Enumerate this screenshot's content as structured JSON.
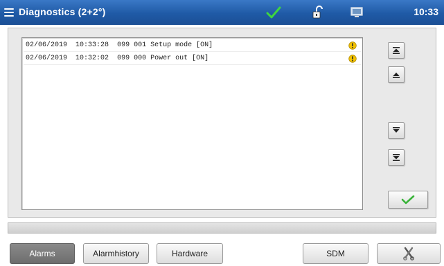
{
  "header": {
    "title": "Diagnostics (2+2°)",
    "time": "10:33",
    "menu_icon": "menu-icon",
    "status_icon": "checkmark-icon",
    "lock_icon": "lock-icon",
    "monitor_icon": "monitor-icon",
    "status_color": "#2fbf2f"
  },
  "alarms": [
    {
      "date": "02/06/2019",
      "time": "10:33:28",
      "code": "099 001",
      "message": "Setup mode [ON]",
      "icon": "warning-icon"
    },
    {
      "date": "02/06/2019",
      "time": "10:32:02",
      "code": "099 000",
      "message": "Power out [ON]",
      "icon": "warning-icon"
    }
  ],
  "scroll_buttons": {
    "top": "scroll-top-icon",
    "up": "scroll-up-icon",
    "down": "scroll-down-icon",
    "bottom": "scroll-bottom-icon"
  },
  "confirm_icon": "checkmark-icon",
  "tabs": [
    {
      "label": "Alarms",
      "active": true
    },
    {
      "label": "Alarmhistory",
      "active": false
    },
    {
      "label": "Hardware",
      "active": false
    },
    {
      "label": "SDM",
      "active": false
    }
  ],
  "tools_icon": "tools-icon",
  "colors": {
    "titlebar": "#1f5aa6",
    "warning": "#f2c200",
    "active_tab": "#7a7a7a"
  }
}
